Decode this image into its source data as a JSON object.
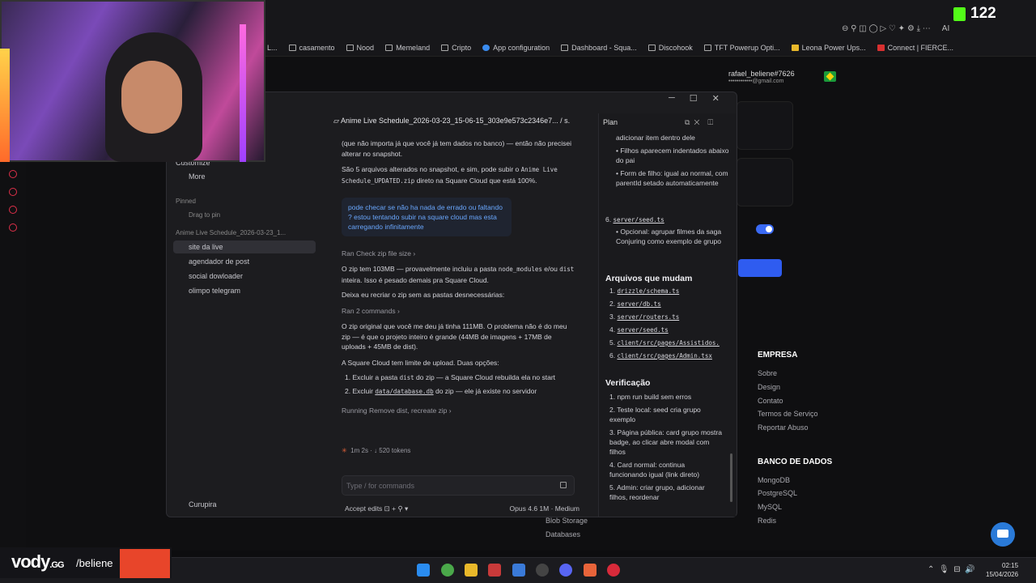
{
  "browser": {
    "kick_count": "122",
    "bookmarks": [
      "L...",
      "casamento",
      "Nood",
      "Memeland",
      "Cripto",
      "App configuration",
      "Dashboard - Squa...",
      "Discohook",
      "TFT Powerup Opti...",
      "Leona Power Ups...",
      "Connect | FIERCE..."
    ],
    "browser_icons": "⊖ ⚲ ◫ ◯ ▷ ♡ ✦ ⚙ ⤓ ⋯",
    "ai_label": "AI"
  },
  "background_page": {
    "account_name": "rafael_beliene#7626",
    "account_email": "••••••••••••@gmail.com",
    "footer": {
      "empresa_heading": "EMPRESA",
      "empresa_links": [
        "Sobre",
        "Design",
        "Contato",
        "Termos de Serviço",
        "Reportar Abuso"
      ],
      "banco_heading": "BANCO DE DADOS",
      "banco_links": [
        "MongoDB",
        "PostgreSQL",
        "MySQL",
        "Redis"
      ],
      "under_links": [
        "Blob Storage",
        "Databases"
      ]
    }
  },
  "sidebar": {
    "customize": "Customize",
    "more": "More",
    "pinned_label": "Pinned",
    "drag_to_pin": "Drag to pin",
    "recent_title": "Anime Live Schedule_2026-03-23_1...",
    "items": [
      "site da live",
      "agendador de post",
      "social dowloader",
      "olimpo telegram"
    ],
    "user": "Curupira"
  },
  "chat": {
    "title": "Anime Live Schedule_2026-03-23_15-06-15_303e9e573c2346e7...  / s.",
    "para1": "(que não importa já que você já tem dados no banco) — então não precisei alterar no snapshot.",
    "para2_a": "São 5 arquivos alterados no snapshot, e sim, pode subir o",
    "para2_code": "Anime Live Schedule_UPDATED.zip",
    "para2_b": "direto na Square Cloud que está 100%.",
    "user_message": "pode checar se não ha nada de errado ou faltando ? estou tentando subir na square cloud mas esta carregando infinitamente",
    "ran_check": "Ran Check zip file size  ›",
    "para3_a": "O zip tem 103MB — provavelmente incluiu a pasta",
    "para3_code1": "node_modules",
    "para3_b": "e/ou",
    "para3_code2": "dist",
    "para3_c": "inteira. Isso é pesado demais pra Square Cloud.",
    "para4": "Deixa eu recriar o zip sem as pastas desnecessárias:",
    "ran_two": "Ran 2 commands  ›",
    "para5": "O zip original que você me deu já tinha 111MB. O problema não é do meu zip — é que o projeto inteiro é grande (44MB de imagens + 17MB de uploads + 45MB de dist).",
    "para6": "A Square Cloud tem limite de upload. Duas opções:",
    "option1_a": "1. Excluir a pasta",
    "option1_code": "dist",
    "option1_b": "do zip — a Square Cloud rebuilda ela no start",
    "option2_a": "2. Excluir",
    "option2_code": "data/database.db",
    "option2_b": "do zip — ele já existe no servidor",
    "running": "Running Remove dist, recreate zip  ›",
    "status": "1m 2s · ↓ 520 tokens",
    "input_placeholder": "Type / for commands",
    "accept_edits": "Accept edits   ⊡   +   ⚲ ▾",
    "model": "Opus 4.6 1M · Medium"
  },
  "plan": {
    "label": "Plan",
    "top_items": [
      "adicionar item dentro dele",
      "Filhos aparecem indentados abaixo do pai",
      "Form de filho: igual ao normal, com parentId setado automaticamente"
    ],
    "step6_label": "6.",
    "step6_file": "server/seed.ts",
    "step6_text": "Opcional: agrupar filmes da saga Conjuring como exemplo de grupo",
    "files_heading": "Arquivos que mudam",
    "files": [
      "drizzle/schema.ts",
      "server/db.ts",
      "server/routers.ts",
      "server/seed.ts",
      "client/src/pages/Assistidos.",
      "client/src/pages/Admin.tsx"
    ],
    "verif_heading": "Verificação",
    "verif_items": [
      "npm run build sem erros",
      "Teste local: seed cria grupo exemplo",
      "Página pública: card grupo mostra badge, ao clicar abre modal com filhos",
      "Card normal: continua funcionando igual (link direto)",
      "Admin: criar grupo, adicionar filhos, reordenar"
    ]
  },
  "taskbar": {
    "time": "02:15",
    "date": "15/04/2026"
  },
  "overlay": {
    "brand": "vody",
    "brand_suffix": ".GG",
    "user": "/beliene"
  }
}
